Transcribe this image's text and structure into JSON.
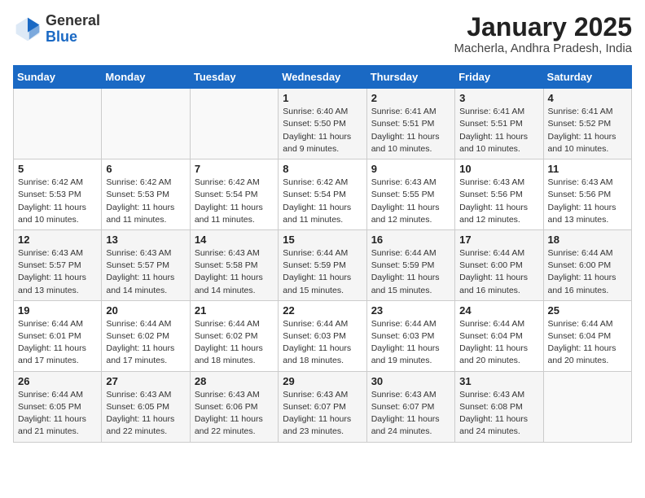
{
  "header": {
    "logo": {
      "general": "General",
      "blue": "Blue"
    },
    "title": "January 2025",
    "subtitle": "Macherla, Andhra Pradesh, India"
  },
  "weekdays": [
    "Sunday",
    "Monday",
    "Tuesday",
    "Wednesday",
    "Thursday",
    "Friday",
    "Saturday"
  ],
  "weeks": [
    [
      {
        "day": "",
        "detail": ""
      },
      {
        "day": "",
        "detail": ""
      },
      {
        "day": "",
        "detail": ""
      },
      {
        "day": "1",
        "detail": "Sunrise: 6:40 AM\nSunset: 5:50 PM\nDaylight: 11 hours and 9 minutes."
      },
      {
        "day": "2",
        "detail": "Sunrise: 6:41 AM\nSunset: 5:51 PM\nDaylight: 11 hours and 10 minutes."
      },
      {
        "day": "3",
        "detail": "Sunrise: 6:41 AM\nSunset: 5:51 PM\nDaylight: 11 hours and 10 minutes."
      },
      {
        "day": "4",
        "detail": "Sunrise: 6:41 AM\nSunset: 5:52 PM\nDaylight: 11 hours and 10 minutes."
      }
    ],
    [
      {
        "day": "5",
        "detail": "Sunrise: 6:42 AM\nSunset: 5:53 PM\nDaylight: 11 hours and 10 minutes."
      },
      {
        "day": "6",
        "detail": "Sunrise: 6:42 AM\nSunset: 5:53 PM\nDaylight: 11 hours and 11 minutes."
      },
      {
        "day": "7",
        "detail": "Sunrise: 6:42 AM\nSunset: 5:54 PM\nDaylight: 11 hours and 11 minutes."
      },
      {
        "day": "8",
        "detail": "Sunrise: 6:42 AM\nSunset: 5:54 PM\nDaylight: 11 hours and 11 minutes."
      },
      {
        "day": "9",
        "detail": "Sunrise: 6:43 AM\nSunset: 5:55 PM\nDaylight: 11 hours and 12 minutes."
      },
      {
        "day": "10",
        "detail": "Sunrise: 6:43 AM\nSunset: 5:56 PM\nDaylight: 11 hours and 12 minutes."
      },
      {
        "day": "11",
        "detail": "Sunrise: 6:43 AM\nSunset: 5:56 PM\nDaylight: 11 hours and 13 minutes."
      }
    ],
    [
      {
        "day": "12",
        "detail": "Sunrise: 6:43 AM\nSunset: 5:57 PM\nDaylight: 11 hours and 13 minutes."
      },
      {
        "day": "13",
        "detail": "Sunrise: 6:43 AM\nSunset: 5:57 PM\nDaylight: 11 hours and 14 minutes."
      },
      {
        "day": "14",
        "detail": "Sunrise: 6:43 AM\nSunset: 5:58 PM\nDaylight: 11 hours and 14 minutes."
      },
      {
        "day": "15",
        "detail": "Sunrise: 6:44 AM\nSunset: 5:59 PM\nDaylight: 11 hours and 15 minutes."
      },
      {
        "day": "16",
        "detail": "Sunrise: 6:44 AM\nSunset: 5:59 PM\nDaylight: 11 hours and 15 minutes."
      },
      {
        "day": "17",
        "detail": "Sunrise: 6:44 AM\nSunset: 6:00 PM\nDaylight: 11 hours and 16 minutes."
      },
      {
        "day": "18",
        "detail": "Sunrise: 6:44 AM\nSunset: 6:00 PM\nDaylight: 11 hours and 16 minutes."
      }
    ],
    [
      {
        "day": "19",
        "detail": "Sunrise: 6:44 AM\nSunset: 6:01 PM\nDaylight: 11 hours and 17 minutes."
      },
      {
        "day": "20",
        "detail": "Sunrise: 6:44 AM\nSunset: 6:02 PM\nDaylight: 11 hours and 17 minutes."
      },
      {
        "day": "21",
        "detail": "Sunrise: 6:44 AM\nSunset: 6:02 PM\nDaylight: 11 hours and 18 minutes."
      },
      {
        "day": "22",
        "detail": "Sunrise: 6:44 AM\nSunset: 6:03 PM\nDaylight: 11 hours and 18 minutes."
      },
      {
        "day": "23",
        "detail": "Sunrise: 6:44 AM\nSunset: 6:03 PM\nDaylight: 11 hours and 19 minutes."
      },
      {
        "day": "24",
        "detail": "Sunrise: 6:44 AM\nSunset: 6:04 PM\nDaylight: 11 hours and 20 minutes."
      },
      {
        "day": "25",
        "detail": "Sunrise: 6:44 AM\nSunset: 6:04 PM\nDaylight: 11 hours and 20 minutes."
      }
    ],
    [
      {
        "day": "26",
        "detail": "Sunrise: 6:44 AM\nSunset: 6:05 PM\nDaylight: 11 hours and 21 minutes."
      },
      {
        "day": "27",
        "detail": "Sunrise: 6:43 AM\nSunset: 6:05 PM\nDaylight: 11 hours and 22 minutes."
      },
      {
        "day": "28",
        "detail": "Sunrise: 6:43 AM\nSunset: 6:06 PM\nDaylight: 11 hours and 22 minutes."
      },
      {
        "day": "29",
        "detail": "Sunrise: 6:43 AM\nSunset: 6:07 PM\nDaylight: 11 hours and 23 minutes."
      },
      {
        "day": "30",
        "detail": "Sunrise: 6:43 AM\nSunset: 6:07 PM\nDaylight: 11 hours and 24 minutes."
      },
      {
        "day": "31",
        "detail": "Sunrise: 6:43 AM\nSunset: 6:08 PM\nDaylight: 11 hours and 24 minutes."
      },
      {
        "day": "",
        "detail": ""
      }
    ]
  ]
}
